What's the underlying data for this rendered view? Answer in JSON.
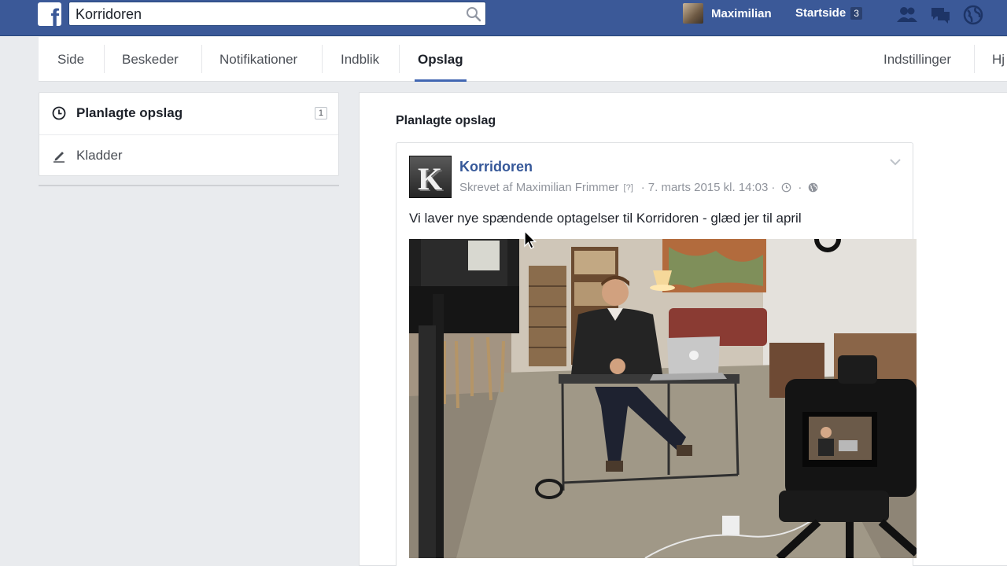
{
  "topbar": {
    "search_value": "Korridoren",
    "user_name": "Maximilian",
    "home_label": "Startside",
    "home_count": "3"
  },
  "nav": {
    "tabs": [
      "Side",
      "Beskeder",
      "Notifikationer",
      "Indblik",
      "Opslag"
    ],
    "active_tab": "Opslag",
    "right_items": [
      "Indstillinger",
      "Hj"
    ]
  },
  "sidebar": {
    "items": [
      {
        "label": "Planlagte opslag",
        "count": "1",
        "icon": "clock-icon"
      },
      {
        "label": "Kladder",
        "icon": "pencil-icon"
      }
    ]
  },
  "main": {
    "section_title": "Planlagte opslag",
    "post": {
      "page_name": "Korridoren",
      "avatar_letter": "K",
      "author_prefix": "Skrevet af Maximilian Frimmer",
      "help_marker": "[?]",
      "separator": "·",
      "datetime": "7. marts 2015 kl. 14:03",
      "text": "Vi laver nye spændende optagelser til Korridoren - glæd jer til april"
    }
  },
  "colors": {
    "brand_blue": "#3b5998",
    "link_blue": "#365899",
    "active_tab_underline": "#4267b2"
  }
}
